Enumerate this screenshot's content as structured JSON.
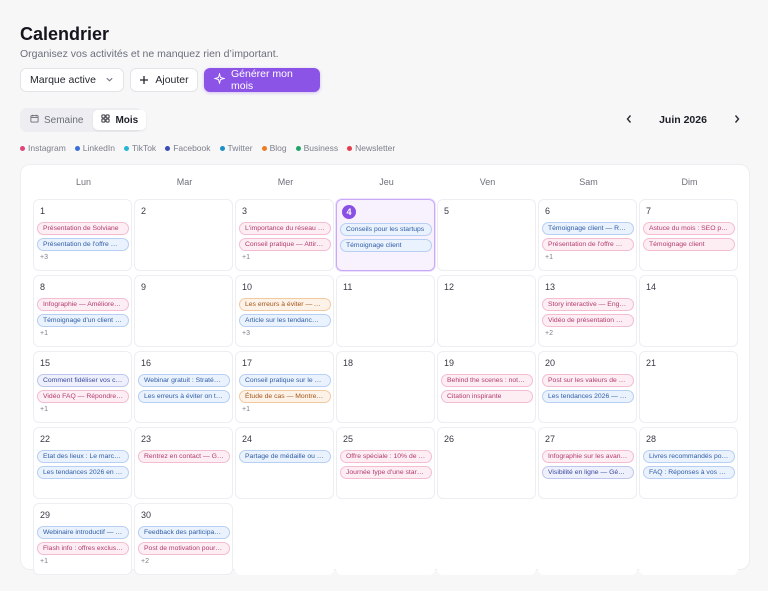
{
  "header": {
    "title": "Calendrier",
    "subtitle": "Organisez vos activités et ne manquez rien d’important."
  },
  "toolbar": {
    "brand_select": "Marque active",
    "add_label": "Ajouter",
    "generate_label": "Générer mon mois"
  },
  "view_switch": {
    "week_label": "Semaine",
    "month_label": "Mois",
    "active": "month"
  },
  "month_nav": {
    "label": "Juin 2026"
  },
  "colors": {
    "accent": "#8c54e6",
    "instagram": "#e0457b",
    "linkedin": "#3a6fd8",
    "tiktok": "#27b6d6",
    "facebook": "#3b4db5",
    "twitter": "#1d8fc9",
    "blog": "#ef7b22",
    "business": "#1ea36a",
    "newsletter": "#e33d4d"
  },
  "legend": [
    {
      "label": "Instagram",
      "color": "#e0457b"
    },
    {
      "label": "LinkedIn",
      "color": "#3a6fd8"
    },
    {
      "label": "TikTok",
      "color": "#27b6d6"
    },
    {
      "label": "Facebook",
      "color": "#3b4db5"
    },
    {
      "label": "Twitter",
      "color": "#1d8fc9"
    },
    {
      "label": "Blog",
      "color": "#ef7b22"
    },
    {
      "label": "Business",
      "color": "#1ea36a"
    },
    {
      "label": "Newsletter",
      "color": "#e33d4d"
    }
  ],
  "weekdays": [
    "Lun",
    "Mar",
    "Mer",
    "Jeu",
    "Ven",
    "Sam",
    "Dim"
  ],
  "days": [
    {
      "num": "1",
      "events": [
        {
          "text": "Présentation de Solviane",
          "type": "instagram"
        },
        {
          "text": "Présentation de l'offre …",
          "type": "linkedin"
        }
      ],
      "more": "+3"
    },
    {
      "num": "2",
      "events": [],
      "more": ""
    },
    {
      "num": "3",
      "events": [
        {
          "text": "L'importance du réseau …",
          "type": "instagram"
        },
        {
          "text": "Conseil pratique — Attir…",
          "type": "instagram"
        }
      ],
      "more": "+1"
    },
    {
      "num": "4",
      "today": true,
      "events": [
        {
          "text": "Conseils pour les startups",
          "type": "linkedin"
        },
        {
          "text": "Témoignage client",
          "type": "linkedin"
        }
      ],
      "more": ""
    },
    {
      "num": "5",
      "events": [],
      "more": ""
    },
    {
      "num": "6",
      "events": [
        {
          "text": "Témoignage client — Re…",
          "type": "linkedin"
        },
        {
          "text": "Présentation de l'offre …",
          "type": "instagram"
        }
      ],
      "more": "+1"
    },
    {
      "num": "7",
      "events": [
        {
          "text": "Astuce du mois : SEO po…",
          "type": "instagram"
        },
        {
          "text": "Témoignage client",
          "type": "instagram"
        }
      ],
      "more": ""
    },
    {
      "num": "8",
      "events": [
        {
          "text": "Infographie — Améliorer…",
          "type": "instagram"
        },
        {
          "text": "Témoignage d'un client …",
          "type": "linkedin"
        }
      ],
      "more": "+1"
    },
    {
      "num": "9",
      "events": [],
      "more": ""
    },
    {
      "num": "10",
      "events": [
        {
          "text": "Les erreurs à éviter — A…",
          "type": "blog"
        },
        {
          "text": "Article sur les tendanc…",
          "type": "linkedin"
        }
      ],
      "more": "+3"
    },
    {
      "num": "11",
      "events": [],
      "more": ""
    },
    {
      "num": "12",
      "events": [],
      "more": ""
    },
    {
      "num": "13",
      "events": [
        {
          "text": "Story interactive — Eng…",
          "type": "instagram"
        },
        {
          "text": "Vidéo de présentation —…",
          "type": "instagram"
        }
      ],
      "more": "+2"
    },
    {
      "num": "14",
      "events": [],
      "more": ""
    },
    {
      "num": "15",
      "events": [
        {
          "text": "Comment fidéliser vos c…",
          "type": "facebook"
        },
        {
          "text": "Vidéo FAQ — Répondre …",
          "type": "instagram"
        }
      ],
      "more": "+1"
    },
    {
      "num": "16",
      "events": [
        {
          "text": "Webinar gratuit : Stratég…",
          "type": "linkedin"
        },
        {
          "text": "Les erreurs à éviter on t…",
          "type": "linkedin"
        }
      ],
      "more": ""
    },
    {
      "num": "17",
      "events": [
        {
          "text": "Conseil pratique sur le …",
          "type": "linkedin"
        },
        {
          "text": "Étude de cas — Montrer …",
          "type": "blog"
        }
      ],
      "more": "+1"
    },
    {
      "num": "18",
      "events": [],
      "more": ""
    },
    {
      "num": "19",
      "events": [
        {
          "text": "Behind the scenes : notr…",
          "type": "instagram"
        },
        {
          "text": "Citation inspirante",
          "type": "instagram"
        }
      ],
      "more": ""
    },
    {
      "num": "20",
      "events": [
        {
          "text": "Post sur les valeurs de S…",
          "type": "instagram"
        },
        {
          "text": "Les tendances 2026 — …",
          "type": "linkedin"
        }
      ],
      "more": ""
    },
    {
      "num": "21",
      "events": [],
      "more": ""
    },
    {
      "num": "22",
      "events": [
        {
          "text": "Etat des lieux : Le march…",
          "type": "linkedin"
        },
        {
          "text": "Les tendances 2026 en …",
          "type": "linkedin"
        }
      ],
      "more": ""
    },
    {
      "num": "23",
      "events": [
        {
          "text": "Rentrez en contact — G…",
          "type": "instagram"
        }
      ],
      "more": ""
    },
    {
      "num": "24",
      "events": [
        {
          "text": "Partage de médaille ou d…",
          "type": "linkedin"
        }
      ],
      "more": ""
    },
    {
      "num": "25",
      "events": [
        {
          "text": "Offre spéciale : 10% de r…",
          "type": "instagram"
        },
        {
          "text": "Journée type d'une star…",
          "type": "instagram"
        }
      ],
      "more": ""
    },
    {
      "num": "26",
      "events": [],
      "more": ""
    },
    {
      "num": "27",
      "events": [
        {
          "text": "Infographie sur les avant…",
          "type": "instagram"
        },
        {
          "text": "Visibilité en ligne — Gén…",
          "type": "facebook"
        }
      ],
      "more": ""
    },
    {
      "num": "28",
      "events": [
        {
          "text": "Livres recommandés po…",
          "type": "linkedin"
        },
        {
          "text": "FAQ : Réponses à vos qu…",
          "type": "linkedin"
        }
      ],
      "more": ""
    },
    {
      "num": "29",
      "events": [
        {
          "text": "Webinaire introductif — …",
          "type": "linkedin"
        },
        {
          "text": "Flash info : offres exclus…",
          "type": "instagram"
        }
      ],
      "more": "+1"
    },
    {
      "num": "30",
      "events": [
        {
          "text": "Feedback des participan…",
          "type": "linkedin"
        },
        {
          "text": "Post de motivation pour …",
          "type": "instagram"
        }
      ],
      "more": "+2"
    }
  ]
}
